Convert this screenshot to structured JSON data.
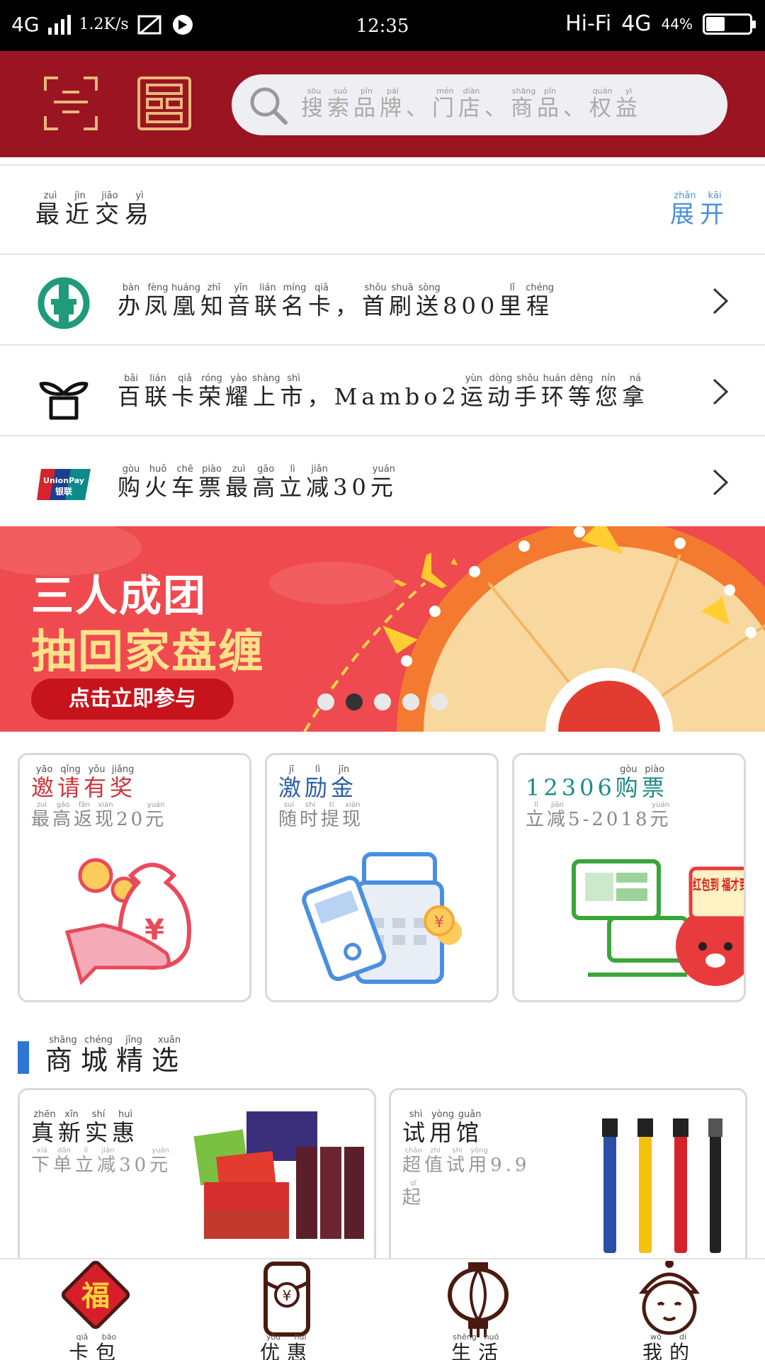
{
  "status_bar": {
    "network": "4G",
    "speed": "1.2K/s",
    "time": "12:35",
    "hifi": "Hi-Fi",
    "network_right": "4G",
    "battery_text": "44%",
    "battery_level": 0.44
  },
  "header": {
    "search_placeholder": [
      {
        "c": "搜",
        "p": "sōu"
      },
      {
        "c": "索",
        "p": "suǒ"
      },
      {
        "c": "品",
        "p": "pǐn"
      },
      {
        "c": "牌",
        "p": "pái"
      },
      {
        "c": "、",
        "p": ""
      },
      {
        "c": "门",
        "p": "mén"
      },
      {
        "c": "店",
        "p": "diàn"
      },
      {
        "c": "、",
        "p": ""
      },
      {
        "c": "商",
        "p": "shāng"
      },
      {
        "c": "品",
        "p": "pǐn"
      },
      {
        "c": "、",
        "p": ""
      },
      {
        "c": "权",
        "p": "quán"
      },
      {
        "c": "益",
        "p": "yì"
      }
    ]
  },
  "recent": {
    "title": [
      {
        "c": "最",
        "p": "zuì"
      },
      {
        "c": "近",
        "p": "jìn"
      },
      {
        "c": "交",
        "p": "jiāo"
      },
      {
        "c": "易",
        "p": "yì"
      }
    ],
    "expand": [
      {
        "c": "展",
        "p": "zhǎn"
      },
      {
        "c": "开",
        "p": "kāi"
      }
    ],
    "items": [
      {
        "icon": "abc-bank-icon",
        "text": [
          {
            "c": "办",
            "p": "bàn"
          },
          {
            "c": "凤",
            "p": "fèng"
          },
          {
            "c": "凰",
            "p": "huáng"
          },
          {
            "c": "知",
            "p": "zhī"
          },
          {
            "c": "音",
            "p": "yīn"
          },
          {
            "c": "联",
            "p": "lián"
          },
          {
            "c": "名",
            "p": "míng"
          },
          {
            "c": "卡",
            "p": "qiǎ"
          },
          {
            "c": "，",
            "p": ""
          },
          {
            "c": "首",
            "p": "shǒu"
          },
          {
            "c": "刷",
            "p": "shuā"
          },
          {
            "c": "送",
            "p": "sòng"
          },
          {
            "c": "800",
            "p": ""
          },
          {
            "c": "里",
            "p": "lǐ"
          },
          {
            "c": "程",
            "p": "chéng"
          }
        ]
      },
      {
        "icon": "bailian-sprout-icon",
        "text": [
          {
            "c": "百",
            "p": "bǎi"
          },
          {
            "c": "联",
            "p": "lián"
          },
          {
            "c": "卡",
            "p": "qiǎ"
          },
          {
            "c": "荣",
            "p": "róng"
          },
          {
            "c": "耀",
            "p": "yào"
          },
          {
            "c": "上",
            "p": "shàng"
          },
          {
            "c": "市",
            "p": "shì"
          },
          {
            "c": "，",
            "p": ""
          },
          {
            "c": "Mambo2",
            "p": ""
          },
          {
            "c": "运",
            "p": "yùn"
          },
          {
            "c": "动",
            "p": "dòng"
          },
          {
            "c": "手",
            "p": "shǒu"
          },
          {
            "c": "环",
            "p": "huán"
          },
          {
            "c": "等",
            "p": "děng"
          },
          {
            "c": "您",
            "p": "nín"
          },
          {
            "c": "拿",
            "p": "ná"
          }
        ]
      },
      {
        "icon": "unionpay-icon",
        "text": [
          {
            "c": "购",
            "p": "gòu"
          },
          {
            "c": "火",
            "p": "huǒ"
          },
          {
            "c": "车",
            "p": "chē"
          },
          {
            "c": "票",
            "p": "piào"
          },
          {
            "c": "最",
            "p": "zuì"
          },
          {
            "c": "高",
            "p": "gāo"
          },
          {
            "c": "立",
            "p": "lì"
          },
          {
            "c": "减",
            "p": "jiǎn"
          },
          {
            "c": "30",
            "p": ""
          },
          {
            "c": "元",
            "p": "yuán"
          }
        ]
      }
    ]
  },
  "banner": {
    "line1": "三人成团",
    "line2": "抽回家盘缠",
    "cta": "点击立即参与",
    "dots": 5,
    "active_dot": 1
  },
  "unionpay_text": {
    "top": "UnionPay",
    "bottom": "银联"
  },
  "features": [
    {
      "title_color": "#c9353d",
      "title": [
        {
          "c": "邀",
          "p": "yāo"
        },
        {
          "c": "请",
          "p": "qǐng"
        },
        {
          "c": "有",
          "p": "yǒu"
        },
        {
          "c": "奖",
          "p": "jiǎng"
        }
      ],
      "subtitle": [
        {
          "c": "最",
          "p": "zuì"
        },
        {
          "c": "高",
          "p": "gāo"
        },
        {
          "c": "返",
          "p": "fǎn"
        },
        {
          "c": "现",
          "p": "xiàn"
        },
        {
          "c": "20",
          "p": ""
        },
        {
          "c": "元",
          "p": "yuán"
        }
      ]
    },
    {
      "title_color": "#2a5ea8",
      "title": [
        {
          "c": "激",
          "p": "jī"
        },
        {
          "c": "励",
          "p": "lì"
        },
        {
          "c": "金",
          "p": "jīn"
        }
      ],
      "subtitle": [
        {
          "c": "随",
          "p": "suí"
        },
        {
          "c": "时",
          "p": "shí"
        },
        {
          "c": "提",
          "p": "tí"
        },
        {
          "c": "现",
          "p": "xiàn"
        }
      ]
    },
    {
      "title_color": "#1c8a86",
      "title": [
        {
          "c": "12306",
          "p": ""
        },
        {
          "c": "购",
          "p": "gòu"
        },
        {
          "c": "票",
          "p": "piào"
        }
      ],
      "subtitle": [
        {
          "c": "立",
          "p": "lì"
        },
        {
          "c": "减",
          "p": "jiǎn"
        },
        {
          "c": "5-2018",
          "p": ""
        },
        {
          "c": "元",
          "p": "yuán"
        }
      ],
      "badge": "红包到 福才到"
    }
  ],
  "section": {
    "title": [
      {
        "c": "商",
        "p": "shāng"
      },
      {
        "c": "城",
        "p": "chéng"
      },
      {
        "c": "精",
        "p": "jīng"
      },
      {
        "c": "选",
        "p": "xuǎn"
      }
    ]
  },
  "mall": [
    {
      "title": [
        {
          "c": "真",
          "p": "zhēn"
        },
        {
          "c": "新",
          "p": "xīn"
        },
        {
          "c": "实",
          "p": "shí"
        },
        {
          "c": "惠",
          "p": "huì"
        }
      ],
      "subtitle": [
        {
          "c": "下",
          "p": "xià"
        },
        {
          "c": "单",
          "p": "dān"
        },
        {
          "c": "立",
          "p": "lì"
        },
        {
          "c": "减",
          "p": "jiǎn"
        },
        {
          "c": "30",
          "p": ""
        },
        {
          "c": "元",
          "p": "yuán"
        }
      ]
    },
    {
      "title": [
        {
          "c": "试",
          "p": "shì"
        },
        {
          "c": "用",
          "p": "yòng"
        },
        {
          "c": "馆",
          "p": "guǎn"
        }
      ],
      "subtitle": [
        {
          "c": "超",
          "p": "chāo"
        },
        {
          "c": "值",
          "p": "zhí"
        },
        {
          "c": "试",
          "p": "shì"
        },
        {
          "c": "用",
          "p": "yòng"
        },
        {
          "c": "9.9",
          "p": ""
        },
        {
          "c": "起",
          "p": "qǐ"
        }
      ]
    }
  ],
  "bottom_nav": [
    {
      "label": [
        {
          "c": "卡",
          "p": "qiǎ"
        },
        {
          "c": "包",
          "p": "bāo"
        }
      ]
    },
    {
      "label": [
        {
          "c": "优",
          "p": "yōu"
        },
        {
          "c": "惠",
          "p": "huì"
        }
      ]
    },
    {
      "label": [
        {
          "c": "生",
          "p": "shēng"
        },
        {
          "c": "活",
          "p": "huó"
        }
      ]
    },
    {
      "label": [
        {
          "c": "我",
          "p": "wǒ"
        },
        {
          "c": "的",
          "p": "dí"
        }
      ]
    }
  ],
  "nav_glyphs": {
    "card_pack": "福",
    "coupon": "¥",
    "feature_yen": "¥"
  },
  "colors": {
    "header_red": "#9b1422",
    "accent_blue": "#4a90d9",
    "banner_red": "#ef4a4f",
    "section_blue": "#2e74d2"
  }
}
